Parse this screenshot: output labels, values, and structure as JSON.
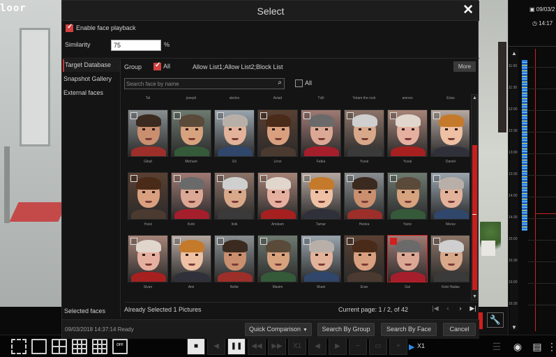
{
  "background": {
    "camera_label": "loor",
    "timeline": {
      "date": "09/03/2",
      "time": "14:17",
      "ticks": [
        "11:00",
        "11:30",
        "12:00",
        "12:30",
        "13:00",
        "13:30",
        "14:00",
        "14:30",
        "15:00",
        "15:30",
        "16:00",
        "16:30"
      ]
    }
  },
  "dialog": {
    "title": "Select",
    "enable_face_playback": {
      "label": "Enable face playback",
      "checked": true
    },
    "similarity": {
      "label": "Similarity",
      "value": "75",
      "unit": "%"
    },
    "sidenav": {
      "items": [
        {
          "label": "Target Database",
          "active": true
        },
        {
          "label": "Snapshot Gallery",
          "active": false
        },
        {
          "label": "External faces",
          "active": false
        }
      ],
      "selected_faces_label": "Selected faces"
    },
    "group": {
      "label": "Group",
      "all_label": "All",
      "all_checked": true,
      "lists": "Allow List1;Allow List2;Block List",
      "more_label": "More"
    },
    "search": {
      "placeholder": "Search face by name",
      "all_label": "All"
    },
    "top_names": [
      "Tal",
      "joseph",
      "akolov",
      "Aviad",
      "Tzlil",
      "Yotam the rock",
      "amnon",
      "Eiras"
    ],
    "rows": [
      {
        "names": [
          "Gilad",
          "Michael",
          "Eli",
          "Liron",
          "Fatka",
          "Yuval",
          "Yuval",
          "Daniel"
        ]
      },
      {
        "names": [
          "Yossi",
          "Kobi",
          "Itzik",
          "Amikam",
          "Tamar",
          "Hedva",
          "Yaniv",
          "Merav"
        ]
      },
      {
        "names": [
          "Sivan",
          "Ami",
          "Nofar",
          "Maxim",
          "Shani",
          "Eran",
          "Gal",
          "Kobi Hadas"
        ]
      }
    ],
    "selected_face": "Gal",
    "selection_status": "Already Selected 1 Pictures",
    "pagination": {
      "label": "Current page: 1 / 2, of 42"
    },
    "footer": {
      "status": "09/03/2018 14:37:14 Ready",
      "quick_comparison": "Quick Comparison",
      "search_by_group": "Search By Group",
      "search_by_face": "Search By Face",
      "cancel": "Cancel"
    }
  },
  "toolbar": {
    "speed": "X1"
  },
  "colors": {
    "accent_red": "#d21e1e",
    "timeline_blue": "#2d7fe0",
    "dialog_bg": "#141414"
  }
}
